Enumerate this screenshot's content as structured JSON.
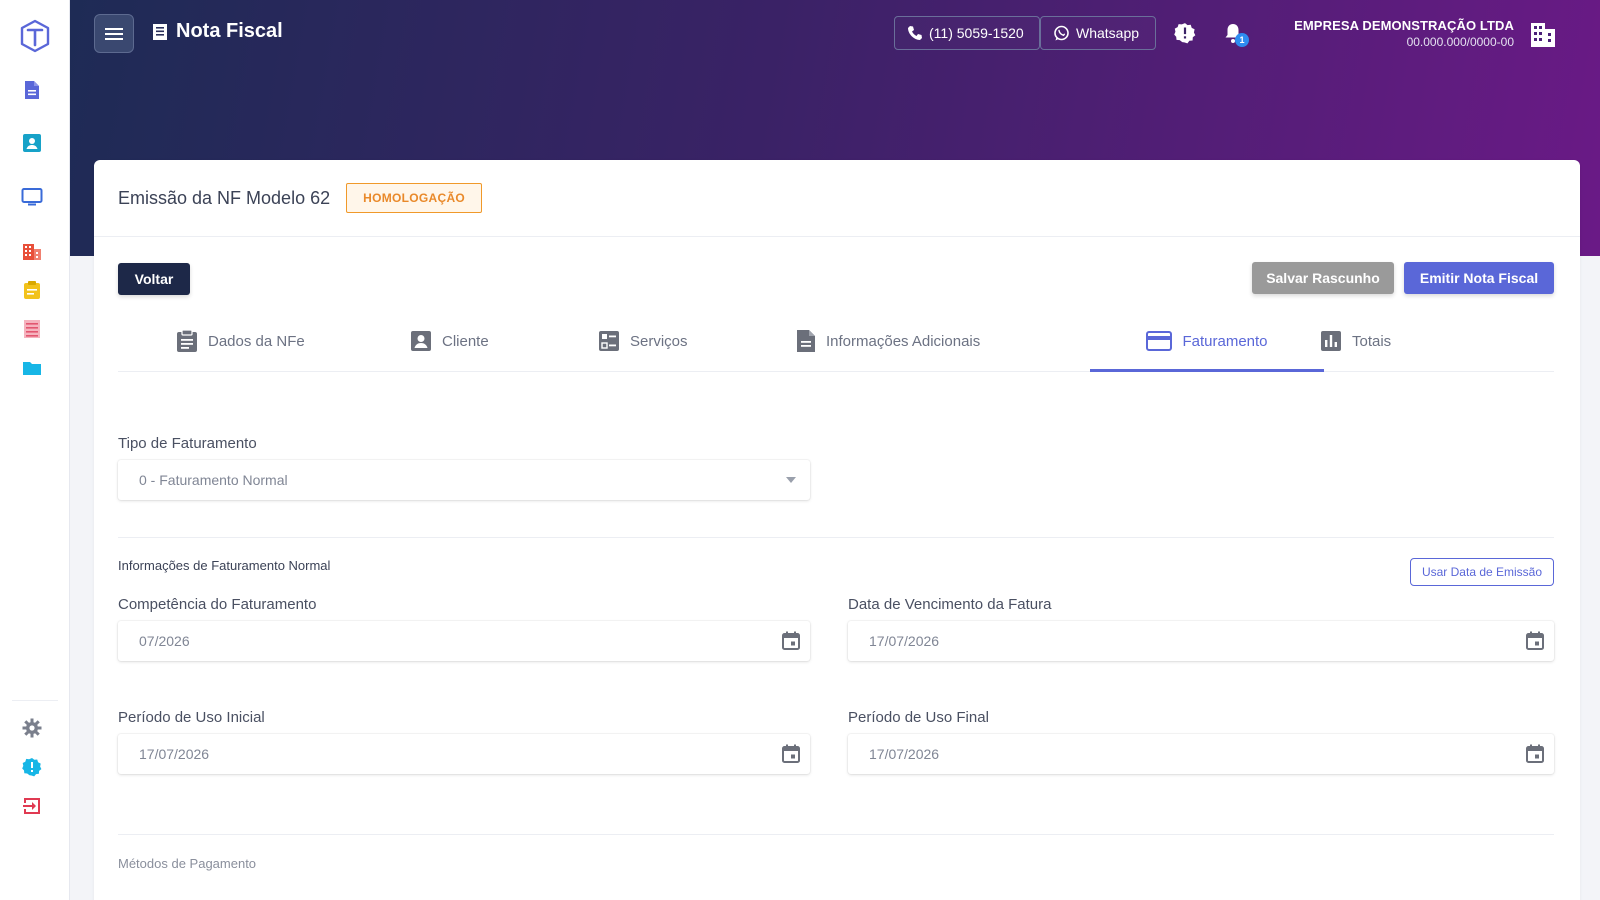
{
  "header": {
    "title": "Nota Fiscal",
    "phone_label": "(11) 5059-1520",
    "whatsapp_label": "Whatsapp",
    "notification_count": "1",
    "company_name": "EMPRESA DEMONSTRAÇÃO LTDA",
    "company_cnpj": "00.000.000/0000-00"
  },
  "sidebar": {
    "items": [
      {
        "icon": "document-icon",
        "color": "#5a67d8"
      },
      {
        "icon": "contact-card-icon",
        "color": "#17a2c8"
      },
      {
        "icon": "monitor-icon",
        "color": "#3a6bd8"
      },
      {
        "icon": "building-icon",
        "color": "#e8503a"
      },
      {
        "icon": "clipboard-icon",
        "color": "#f2c21b"
      },
      {
        "icon": "list-icon",
        "color": "#f08a9a"
      },
      {
        "icon": "folder-icon",
        "color": "#17b6e6"
      }
    ],
    "bottom_items": [
      {
        "icon": "gear-icon",
        "color": "#7a7f8c"
      },
      {
        "icon": "alert-badge-icon",
        "color": "#17b6e6"
      },
      {
        "icon": "logout-icon",
        "color": "#e03a52"
      }
    ]
  },
  "page": {
    "title": "Emissão da NF Modelo 62",
    "environment_badge": "HOMOLOGAÇÃO"
  },
  "actions": {
    "back_label": "Voltar",
    "draft_label": "Salvar Rascunho",
    "emit_label": "Emitir Nota Fiscal"
  },
  "tabs": [
    {
      "label": "Dados da NFe",
      "icon": "clipboard-icon",
      "active": false
    },
    {
      "label": "Cliente",
      "icon": "contact-card-icon",
      "active": false
    },
    {
      "label": "Serviços",
      "icon": "checklist-icon",
      "active": false
    },
    {
      "label": "Informações Adicionais",
      "icon": "document-icon",
      "active": false
    },
    {
      "label": "Faturamento",
      "icon": "credit-card-icon",
      "active": true
    },
    {
      "label": "Totais",
      "icon": "bar-chart-icon",
      "active": false
    }
  ],
  "billing": {
    "type_label": "Tipo de Faturamento",
    "type_value": "0 - Faturamento Normal",
    "section_title": "Informações de Faturamento Normal",
    "use_emission_date_label": "Usar Data de Emissão",
    "competencia_label": "Competência do Faturamento",
    "competencia_value": "07/2026",
    "vencimento_label": "Data de Vencimento da Fatura",
    "vencimento_value": "17/07/2026",
    "periodo_inicial_label": "Período de Uso Inicial",
    "periodo_inicial_value": "17/07/2026",
    "periodo_final_label": "Período de Uso Final",
    "periodo_final_value": "17/07/2026",
    "payment_methods_label": "Métodos de Pagamento"
  },
  "colors": {
    "accent": "#5a67d8",
    "dark": "#1d2848",
    "warning": "#e9892a"
  }
}
